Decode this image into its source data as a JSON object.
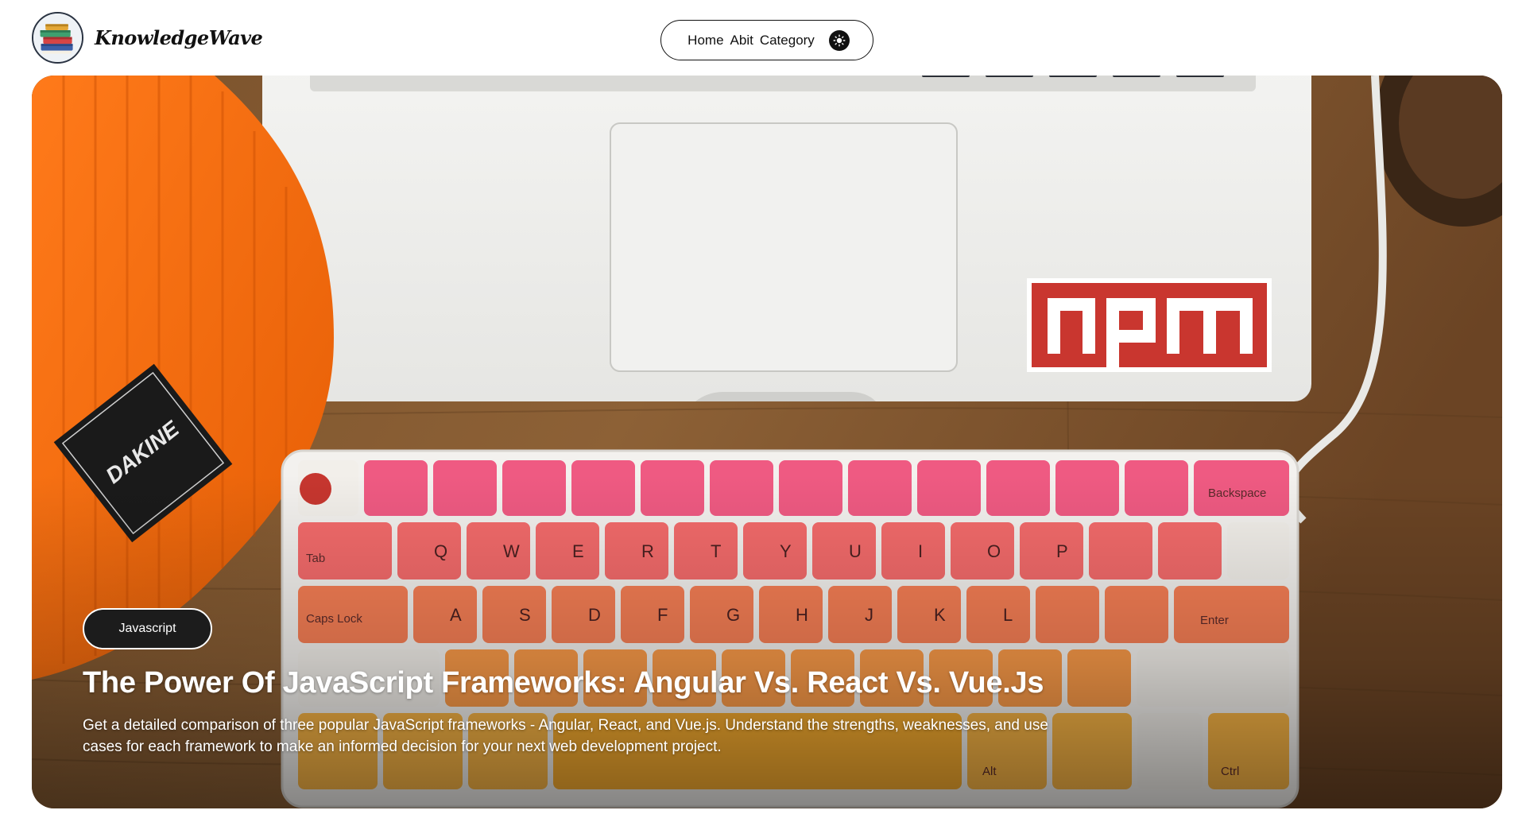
{
  "brand": {
    "name": "KnowledgeWave",
    "logo_icon": "books-stack-icon"
  },
  "nav": {
    "items": [
      {
        "label": "Home"
      },
      {
        "label": "Abit"
      },
      {
        "label": "Category"
      }
    ],
    "theme_toggle_icon": "sun-icon"
  },
  "hero": {
    "image_icon": "keyboard-laptop-photo",
    "tag": "Javascript",
    "title": "The Power Of JavaScript Frameworks: Angular Vs. React Vs. Vue.Js",
    "description": "Get a detailed comparison of three popular JavaScript frameworks - Angular, React, and Vue.js. Understand the strengths, weaknesses, and use cases for each framework to make an informed decision for your next web development project."
  },
  "colors": {
    "tag_background": "#1c1c1c",
    "text_dark": "#111111",
    "hero_text": "#ffffff"
  }
}
